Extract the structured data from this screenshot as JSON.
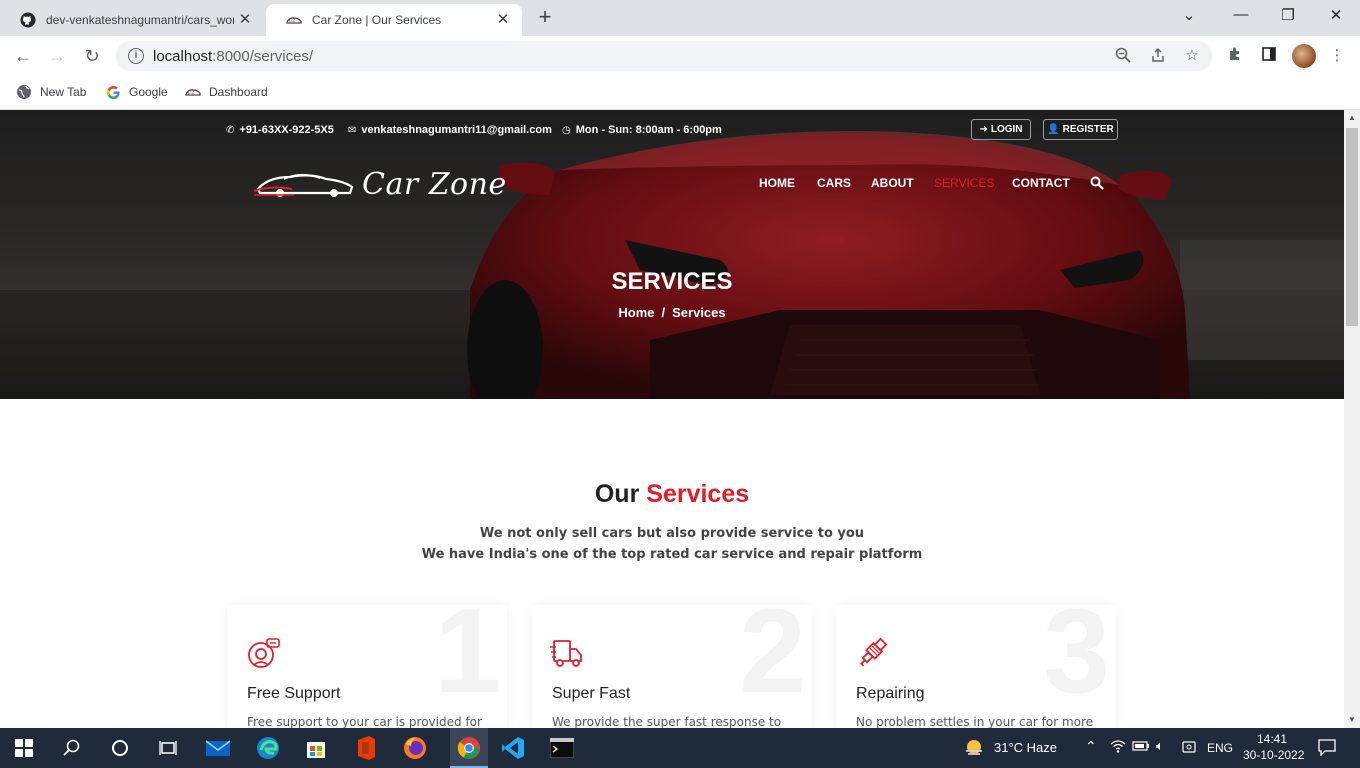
{
  "browser": {
    "tabs": [
      {
        "title": "dev-venkateshnagumantri/cars_wor",
        "icon": "github-icon",
        "active": false
      },
      {
        "title": "Car Zone | Our Services",
        "icon": "carzone-favicon",
        "active": true
      }
    ],
    "address": {
      "host": "localhost",
      "path": ":8000/services/"
    },
    "bookmarks": [
      {
        "label": "New Tab",
        "icon": "globe-icon"
      },
      {
        "label": "Google",
        "icon": "google-icon"
      },
      {
        "label": "Dashboard",
        "icon": "carzone-favicon"
      }
    ]
  },
  "site": {
    "topbar": {
      "phone": "+91-63XX-922-5X5",
      "email": "venkateshnagumantri11@gmail.com",
      "hours": "Mon - Sun: 8:00am - 6:00pm",
      "login": "LOGIN",
      "register": "REGISTER"
    },
    "logo_text": "Car Zone",
    "nav": [
      "HOME",
      "CARS",
      "ABOUT",
      "SERVICES",
      "CONTACT"
    ],
    "active_nav": "SERVICES",
    "hero": {
      "title": "SERVICES",
      "breadcrumb_home": "Home",
      "breadcrumb_sep": "/",
      "breadcrumb_current": "Services"
    },
    "services": {
      "heading_dark": "Our",
      "heading_red": "Services",
      "sub1": "We not only sell cars but also provide service to you",
      "sub2": "We have India's one of the top rated car service and repair platform",
      "cards": [
        {
          "num": "1",
          "title": "Free Support",
          "text": "Free support to your car is provided for",
          "icon": "support-headset-icon"
        },
        {
          "num": "2",
          "title": "Super Fast",
          "text": "We provide the super fast response to",
          "icon": "delivery-truck-icon"
        },
        {
          "num": "3",
          "title": "Repairing",
          "text": "No problem settles in your car for more",
          "icon": "spark-plug-icon"
        }
      ]
    }
  },
  "colors": {
    "accent": "#e01e26"
  },
  "taskbar": {
    "weather": "31°C  Haze",
    "language": "ENG",
    "time": "14:41",
    "date": "30-10-2022"
  }
}
